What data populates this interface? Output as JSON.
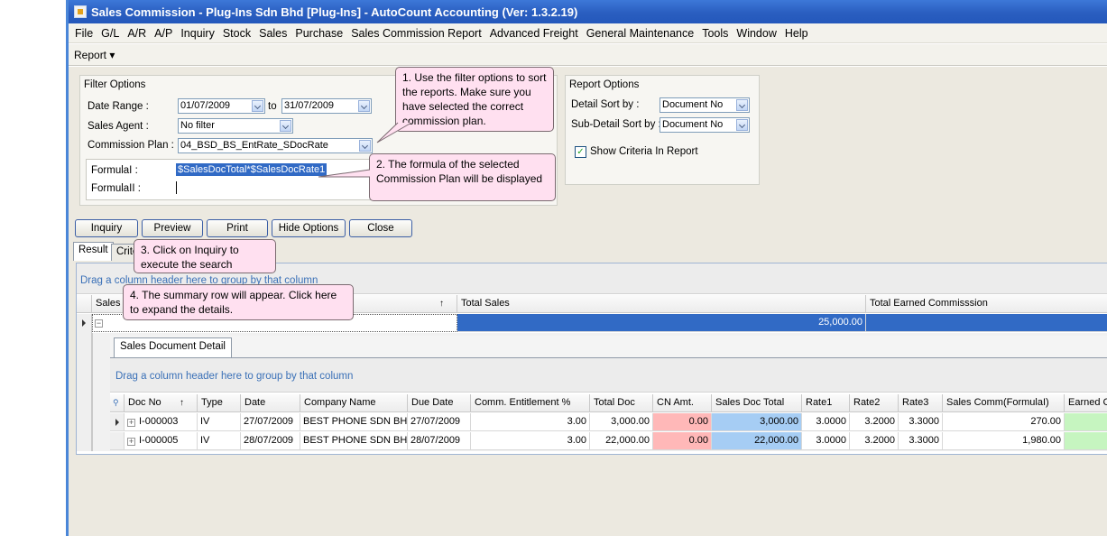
{
  "window": {
    "title": "Sales Commission - Plug-Ins Sdn Bhd [Plug-Ins] - AutoCount Accounting (Ver: 1.3.2.19)"
  },
  "menu": [
    "File",
    "G/L",
    "A/R",
    "A/P",
    "Inquiry",
    "Stock",
    "Sales",
    "Purchase",
    "Sales Commission Report",
    "Advanced Freight",
    "General Maintenance",
    "Tools",
    "Window",
    "Help"
  ],
  "toolbar": {
    "report": "Report ▾"
  },
  "filter": {
    "title": "Filter Options",
    "date_range_label": "Date Range :",
    "date_from": "01/07/2009",
    "to_label": "to",
    "date_to": "31/07/2009",
    "sales_agent_label": "Sales Agent :",
    "sales_agent": "No filter",
    "commission_plan_label": "Commission Plan :",
    "commission_plan": "04_BSD_BS_EntRate_SDocRate",
    "formula1_label": "FormulaI :",
    "formula1": "$SalesDocTotal*$SalesDocRate1",
    "formula2_label": "FormulaII :"
  },
  "report_options": {
    "title": "Report Options",
    "detail_sort_label": "Detail Sort by :",
    "detail_sort": "Document No",
    "subdetail_sort_label": "Sub-Detail Sort by :",
    "subdetail_sort": "Document No",
    "show_criteria": "Show Criteria In Report"
  },
  "buttons": {
    "inquiry": "Inquiry",
    "preview": "Preview",
    "print": "Print",
    "hide_options": "Hide Options",
    "close": "Close"
  },
  "tabs": {
    "result": "Result",
    "criteria": "Crite"
  },
  "grid": {
    "groupby": "Drag a column header here to group by that column",
    "col_sales": "Sales",
    "col_total_sales": "Total Sales",
    "col_total_earned": "Total Earned Commisssion",
    "summary_total_sales": "25,000.00"
  },
  "detail": {
    "tab": "Sales Document Detail",
    "groupby": "Drag a column header here to group by that column",
    "columns": [
      "Doc No",
      "Type",
      "Date",
      "Company Name",
      "Due Date",
      "Comm. Entitlement %",
      "Total Doc",
      "CN Amt.",
      "Sales Doc Total",
      "Rate1",
      "Rate2",
      "Rate3",
      "Sales Comm(FormulaI)",
      "Earned C"
    ],
    "rows": [
      [
        "I-000003",
        "IV",
        "27/07/2009",
        "BEST PHONE SDN BHD",
        "27/07/2009",
        "3.00",
        "3,000.00",
        "0.00",
        "3,000.00",
        "3.0000",
        "3.2000",
        "3.3000",
        "270.00",
        ""
      ],
      [
        "I-000005",
        "IV",
        "28/07/2009",
        "BEST PHONE SDN BHD",
        "28/07/2009",
        "3.00",
        "22,000.00",
        "0.00",
        "22,000.00",
        "3.0000",
        "3.2000",
        "3.3000",
        "1,980.00",
        ""
      ]
    ]
  },
  "callouts": {
    "c1": "1. Use the filter options to sort the reports. Make sure you have selected the correct commission plan.",
    "c2": "2. The formula of the selected Commission Plan will be displayed",
    "c3": "3. Click on Inquiry to execute the search",
    "c4": "4. The summary row will appear. Click here to expand the details."
  },
  "colors": {
    "title_bar": "#2a5ec0",
    "selection": "#316ac5",
    "cn_cell": "#ffb8b8",
    "total_cell": "#a6cdf4",
    "callout": "#ffe0f0"
  }
}
